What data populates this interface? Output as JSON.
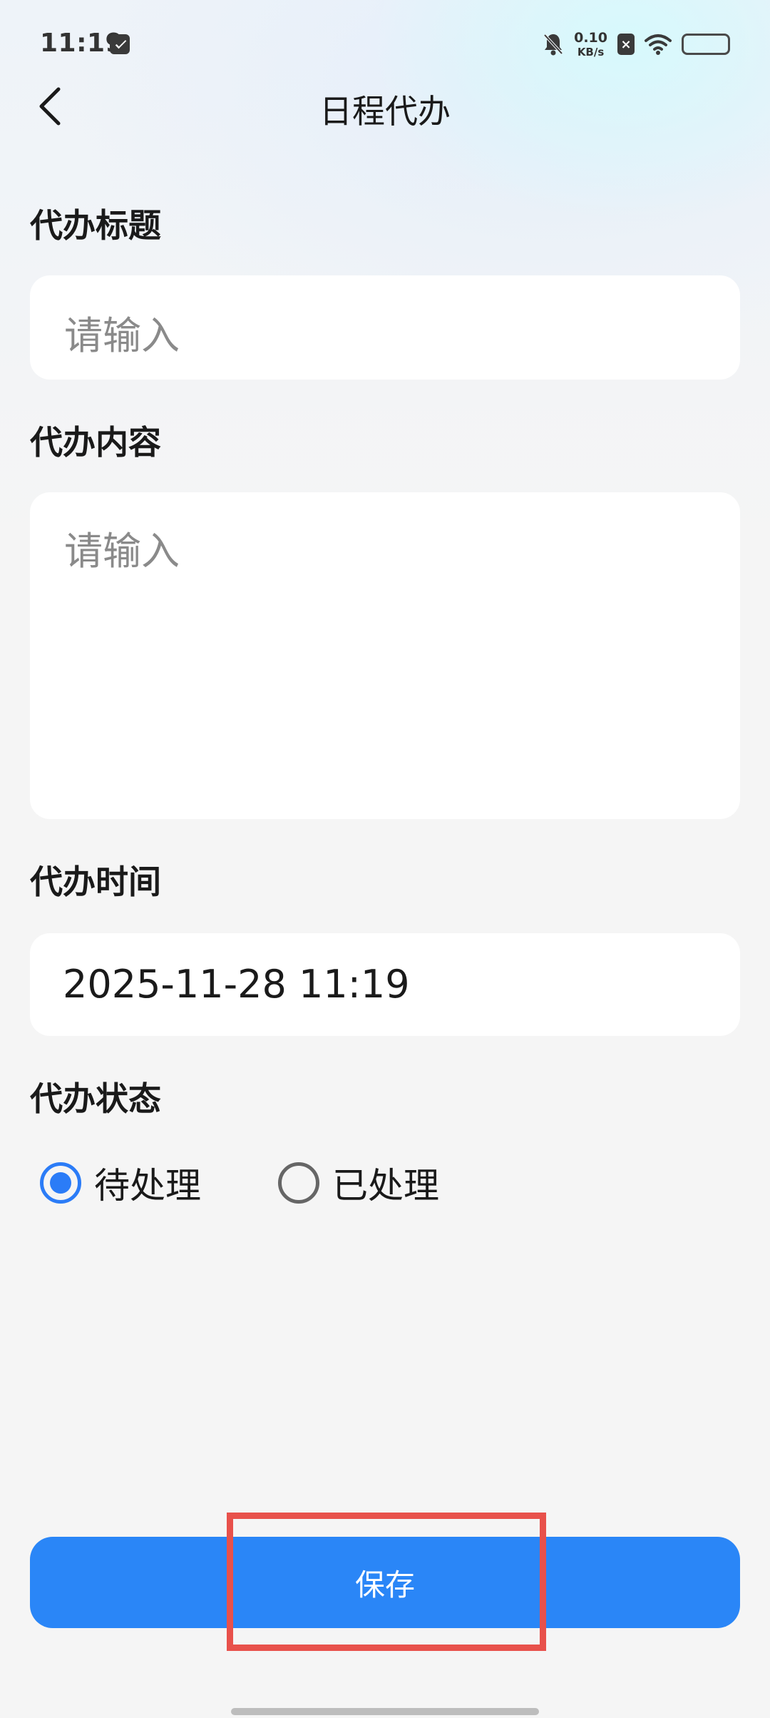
{
  "status_bar": {
    "time": "11:19",
    "net_speed_value": "0.10",
    "net_speed_unit": "KB/s",
    "battery_level": 1.0
  },
  "header": {
    "title": "日程代办"
  },
  "form": {
    "title_field": {
      "label": "代办标题",
      "placeholder": "请输入",
      "value": ""
    },
    "content_field": {
      "label": "代办内容",
      "placeholder": "请输入",
      "value": ""
    },
    "time_field": {
      "label": "代办时间",
      "value": "2025-11-28 11:19"
    },
    "status_field": {
      "label": "代办状态",
      "options": [
        {
          "label": "待处理",
          "checked": true
        },
        {
          "label": "已处理",
          "checked": false
        }
      ]
    }
  },
  "actions": {
    "save_label": "保存"
  },
  "colors": {
    "accent": "#2a86f7",
    "highlight": "#e8514b"
  }
}
